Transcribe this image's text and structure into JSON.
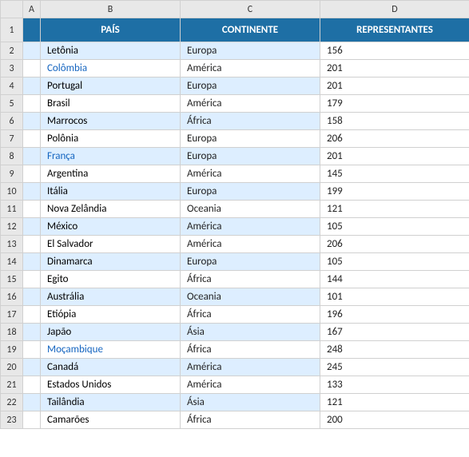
{
  "columns": {
    "row_label": "",
    "a": "A",
    "b": "B",
    "c": "C",
    "d": "D"
  },
  "header_row": {
    "row_num": "1",
    "a": "",
    "b": "PAÍS",
    "c": "CONTINENTE",
    "d": "REPRESENTANTES"
  },
  "rows": [
    {
      "num": "2",
      "pais": "Letônia",
      "continente": "Europa",
      "representantes": "156"
    },
    {
      "num": "3",
      "pais": "Colômbia",
      "continente": "América",
      "representantes": "201"
    },
    {
      "num": "4",
      "pais": "Portugal",
      "continente": "Europa",
      "representantes": "201"
    },
    {
      "num": "5",
      "pais": "Brasil",
      "continente": "América",
      "representantes": "179"
    },
    {
      "num": "6",
      "pais": "Marrocos",
      "continente": "África",
      "representantes": "158"
    },
    {
      "num": "7",
      "pais": "Polônia",
      "continente": "Europa",
      "representantes": "206"
    },
    {
      "num": "8",
      "pais": "França",
      "continente": "Europa",
      "representantes": "201"
    },
    {
      "num": "9",
      "pais": "Argentina",
      "continente": "América",
      "representantes": "145"
    },
    {
      "num": "10",
      "pais": "Itália",
      "continente": "Europa",
      "representantes": "199"
    },
    {
      "num": "11",
      "pais": "Nova Zelândia",
      "continente": "Oceania",
      "representantes": "121"
    },
    {
      "num": "12",
      "pais": "México",
      "continente": "América",
      "representantes": "105"
    },
    {
      "num": "13",
      "pais": "El Salvador",
      "continente": "América",
      "representantes": "206"
    },
    {
      "num": "14",
      "pais": "Dinamarca",
      "continente": "Europa",
      "representantes": "105"
    },
    {
      "num": "15",
      "pais": "Egito",
      "continente": "África",
      "representantes": "144"
    },
    {
      "num": "16",
      "pais": "Austrália",
      "continente": "Oceania",
      "representantes": "101"
    },
    {
      "num": "17",
      "pais": "Etiópia",
      "continente": "África",
      "representantes": "196"
    },
    {
      "num": "18",
      "pais": "Japão",
      "continente": "Ásia",
      "representantes": "167"
    },
    {
      "num": "19",
      "pais": "Moçambique",
      "continente": "África",
      "representantes": "248"
    },
    {
      "num": "20",
      "pais": "Canadá",
      "continente": "América",
      "representantes": "245"
    },
    {
      "num": "21",
      "pais": "Estados Unidos",
      "continente": "América",
      "representantes": "133"
    },
    {
      "num": "22",
      "pais": "Tailândia",
      "continente": "Ásia",
      "representantes": "121"
    },
    {
      "num": "23",
      "pais": "Camarões",
      "continente": "África",
      "representantes": "200"
    }
  ]
}
